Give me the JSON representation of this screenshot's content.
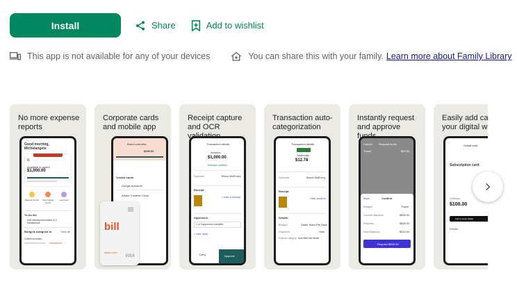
{
  "actions": {
    "install_label": "Install",
    "share_label": "Share",
    "wishlist_label": "Add to wishlist"
  },
  "notices": {
    "devices_text": "This app is not available for any of your devices",
    "family_text": "You can share this with your family.",
    "family_link": "Learn more about Family Library"
  },
  "screenshots": [
    {
      "caption": "No more expense reports",
      "greeting": "Good morning, Michelangelo",
      "available_label": "Available to spend",
      "amount": "$1,000.00",
      "tile_labels": [
        "Request Funds",
        "View budget Funds",
        "Lock Card"
      ],
      "todo_label": "To-do list",
      "todo_item": "Add missing information to 3 transactions",
      "budgets_label": "Budgets assigned to",
      "budgets_link": "View all",
      "budget_item": "Client lunches",
      "brand": "bill"
    },
    {
      "caption": "Corporate cards and mobile app",
      "header": "Brand overview",
      "amount": "$250.00",
      "vendor_label": "Vendor cards",
      "vendors": [
        "Google Amounts",
        "Adobe Creative Cloud"
      ],
      "brand": "bill",
      "card_network": "VISA",
      "card_holder": "Marco Carel"
    },
    {
      "caption": "Receipt capture and OCR validation",
      "header": "Transaction details",
      "merchant": "Amazon",
      "amount": "$1,000.00",
      "status": "Receipt verified",
      "spender_label": "Spender",
      "spender": "Bruce McEnroy",
      "receipt_label": "Receipt",
      "receipt_link": "+ Add a receipt",
      "approvers_label": "Approvers",
      "approvers_value": "1 of 3 approvers complete",
      "add_reply": "+ Add reply",
      "deny_label": "Deny",
      "approve_label": "Approve"
    },
    {
      "caption": "Transaction auto-categorization",
      "header": "Transaction details",
      "merchant": "Starbucks",
      "amount": "$12.78",
      "spender_label": "Spender",
      "spender": "Bruce McEnroy",
      "receipt_label": "Receipt",
      "receipt_link": "+Add another",
      "details_label": "Details",
      "details": [
        [
          "Budget",
          "Sales Team Pte Deck"
        ],
        [
          "Payment",
          "Visa"
        ],
        [
          "Expense category",
          "Auto-filled with Meals"
        ]
      ]
    },
    {
      "caption": "Instantly request and approve funds",
      "cancel": "Cancel",
      "header": "Request funds",
      "item": "Travel",
      "item_amount": "$50.00",
      "back": "Back",
      "confirm": "Confirm",
      "lines": [
        [
          "Budget",
          "Travel"
        ],
        [
          "Current Balance",
          "$500.00"
        ],
        [
          "Request",
          "$500.00"
        ],
        [
          "New Balance",
          "$510.00"
        ]
      ],
      "cta": "Request $500.00"
    },
    {
      "caption": "Easily add card to your digital wallet",
      "header": "Virtual card",
      "subscription": "Subscription card",
      "software_label": "Software",
      "amount": "$100.00",
      "wallet_btn": "Add to Apple Wallet",
      "details_link": "Details"
    }
  ]
}
